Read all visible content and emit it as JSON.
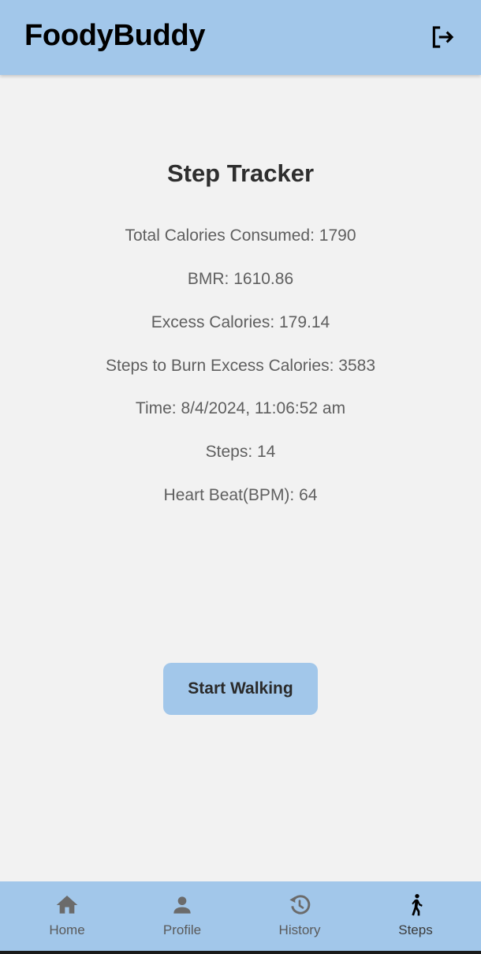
{
  "app_bar": {
    "title": "FoodyBuddy",
    "logout_icon": "logout-icon"
  },
  "main": {
    "title": "Step Tracker",
    "stats": [
      "Total Calories Consumed: 1790",
      "BMR: 1610.86",
      "Excess Calories: 179.14",
      "Steps to Burn Excess Calories: 3583",
      "Time: 8/4/2024, 11:06:52 am",
      "Steps: 14",
      "Heart Beat(BPM): 64"
    ],
    "start_button_label": "Start Walking"
  },
  "bottom_nav": {
    "items": [
      {
        "label": "Home",
        "icon": "home-icon",
        "active": false
      },
      {
        "label": "Profile",
        "icon": "person-icon",
        "active": false
      },
      {
        "label": "History",
        "icon": "history-icon",
        "active": false
      },
      {
        "label": "Steps",
        "icon": "walking-icon",
        "active": true
      }
    ]
  },
  "colors": {
    "accent": "#a2c7ea",
    "background": "#f2f2f2",
    "text_primary": "#2e2e2e",
    "text_secondary": "#5f5f5f",
    "nav_icon_inactive": "#6b6b6b",
    "nav_icon_active": "#000000"
  }
}
